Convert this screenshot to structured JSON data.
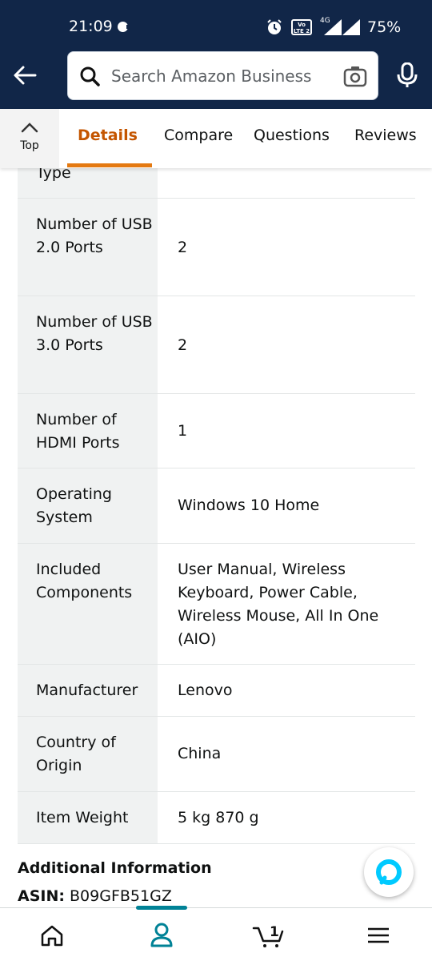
{
  "status_bar": {
    "time": "21:09",
    "lte_label": "Vo LTE 2",
    "network": "4G",
    "battery": "75%"
  },
  "header": {
    "search_placeholder": "Search Amazon Business"
  },
  "tabs": {
    "top_label": "Top",
    "items": [
      "Details",
      "Compare",
      "Questions",
      "Reviews"
    ],
    "active": "Details"
  },
  "specs": [
    {
      "key": "Type",
      "value": ""
    },
    {
      "key": "Number of USB 2.0 Ports",
      "value": "2"
    },
    {
      "key": "Number of USB 3.0 Ports",
      "value": "2"
    },
    {
      "key": "Number of HDMI Ports",
      "value": "1"
    },
    {
      "key": "Operating System",
      "value": "Windows 10 Home"
    },
    {
      "key": "Included Components",
      "value": "User Manual, Wireless Keyboard, Power Cable, Wireless Mouse, All In One (AIO)"
    },
    {
      "key": "Manufacturer",
      "value": "Lenovo"
    },
    {
      "key": "Country of Origin",
      "value": "China"
    },
    {
      "key": "Item Weight",
      "value": "5 kg 870 g"
    }
  ],
  "additional_info": {
    "title": "Additional Information",
    "asin_label": "ASIN:",
    "asin_value": "B09GFB51GZ"
  },
  "bottom_nav": {
    "cart_count": "1"
  },
  "colors": {
    "header_bg": "#112648",
    "active_tab": "#c45500",
    "tab_underline": "#e47911",
    "nav_indicator": "#008296",
    "alexa_ring": "#00caff"
  },
  "icons": [
    "back-arrow-icon",
    "search-icon",
    "camera-icon",
    "mic-icon",
    "chevron-up-icon",
    "home-icon",
    "person-icon",
    "cart-icon",
    "menu-icon",
    "alexa-icon",
    "alarm-icon",
    "signal-icon"
  ]
}
